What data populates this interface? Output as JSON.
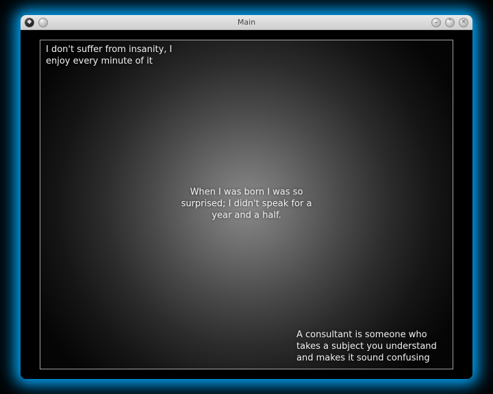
{
  "window": {
    "title": "Main"
  },
  "icons": {
    "sys": "◆",
    "roll": "",
    "min": "⌄",
    "max": "⌃",
    "close": "×"
  },
  "quotes": {
    "top_left": "I don't suffer from insanity, I enjoy every minute of it",
    "center": "When I was born I was so surprised; I didn't speak for a year and a half.",
    "bottom_right": "A consultant is someone who takes a subject you understand and makes it sound confusing"
  }
}
